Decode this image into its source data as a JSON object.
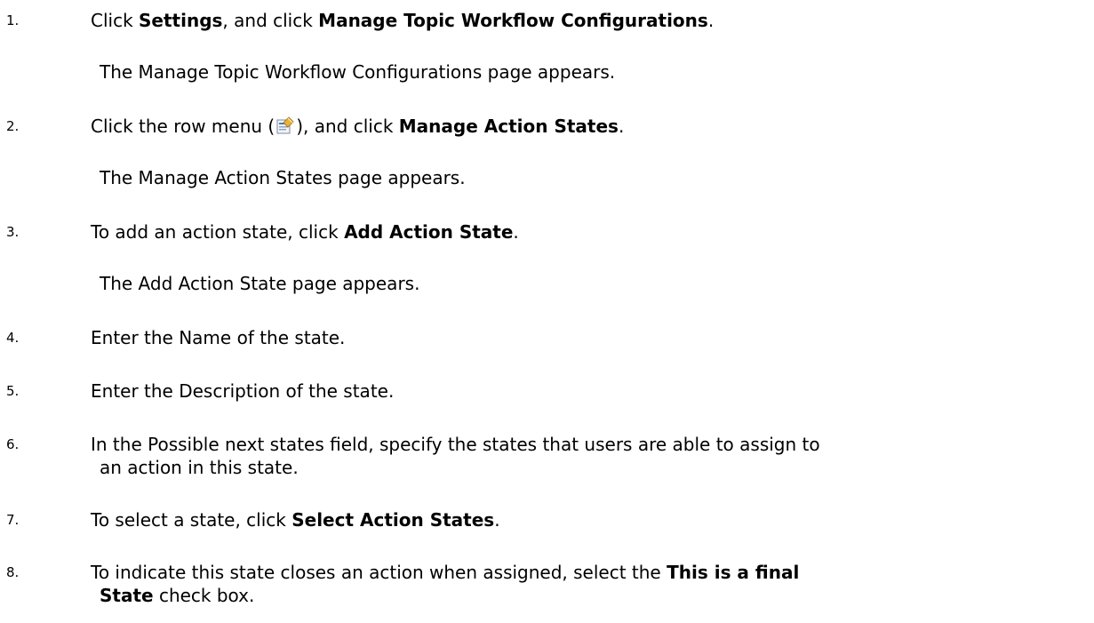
{
  "steps": [
    {
      "number": "1.",
      "parts": [
        "Click ",
        "Settings",
        ", and click ",
        "Manage Topic Workflow Configurations",
        "."
      ],
      "result": "The Manage Topic Workflow Configurations page appears."
    },
    {
      "number": "2.",
      "parts": [
        "Click the row menu (",
        "), and click ",
        "Manage Action States",
        "."
      ],
      "icon": "row-menu-icon",
      "result": "The Manage Action States page appears."
    },
    {
      "number": "3.",
      "parts": [
        "To add an action state, click ",
        "Add Action State",
        "."
      ],
      "result": "The Add Action State page appears."
    },
    {
      "number": "4.",
      "text": "Enter the Name of the state."
    },
    {
      "number": "5.",
      "text": "Enter the Description of the state."
    },
    {
      "number": "6.",
      "line1": "In the Possible next states field, specify the states that users are able to assign to",
      "line2": "an action in this state."
    },
    {
      "number": "7.",
      "parts": [
        "To select a state, click ",
        "Select Action States",
        "."
      ]
    },
    {
      "number": "8.",
      "parts": [
        "To indicate this state closes an action when assigned, select the ",
        "This is a final",
        "State",
        " check box."
      ]
    }
  ]
}
